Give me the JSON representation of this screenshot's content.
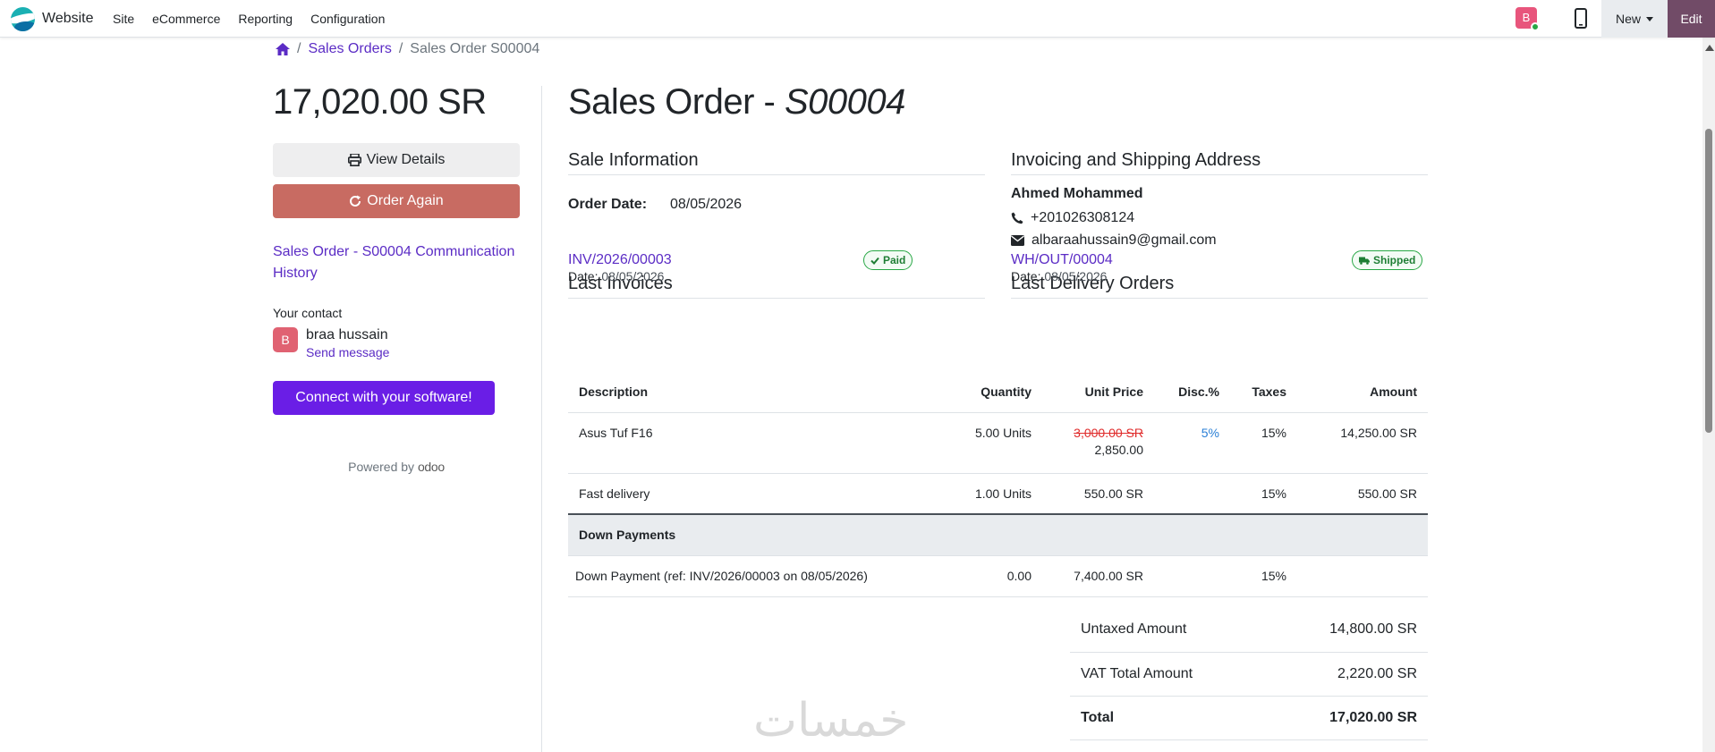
{
  "topbar": {
    "brand": "Website",
    "menu": [
      "Site",
      "eCommerce",
      "Reporting",
      "Configuration"
    ],
    "user_initial": "B",
    "new_label": "New",
    "edit_label": "Edit"
  },
  "breadcrumb": {
    "items": [
      "Sales Orders",
      "Sales Order S00004"
    ]
  },
  "sidebar": {
    "total": "17,020.00 SR",
    "view_details": "View Details",
    "order_again": "Order Again",
    "communication_link": "Sales Order - S00004 Communication History",
    "your_contact": "Your contact",
    "contact_initial": "B",
    "contact_name": "braa hussain",
    "send_message": "Send message",
    "connect_button": "Connect with your software!",
    "powered_by": "Powered by",
    "powered_brand": "odoo"
  },
  "order": {
    "title_prefix": "Sales Order - ",
    "number": "S00004",
    "sale_info_heading": "Sale Information",
    "order_date_label": "Order Date:",
    "order_date": "08/05/2026",
    "address_heading": "Invoicing and Shipping Address",
    "customer_name": "Ahmed Mohammed",
    "phone": "+201026308124",
    "email": "albaraahussain9@gmail.com",
    "invoices_heading": "Last Invoices",
    "invoice_ref": "INV/2026/00003",
    "invoice_status": "Paid",
    "invoice_date_label": "Date:",
    "invoice_date": "08/05/2026",
    "deliveries_heading": "Last Delivery Orders",
    "delivery_ref": "WH/OUT/00004",
    "delivery_status": "Shipped",
    "delivery_date_label": "Date:",
    "delivery_date": "08/05/2026"
  },
  "table": {
    "headers": [
      "Description",
      "Quantity",
      "Unit Price",
      "Disc.%",
      "Taxes",
      "Amount"
    ],
    "rows": [
      {
        "description": "Asus Tuf F16",
        "quantity": "5.00 Units",
        "old_price": "3,000.00 SR",
        "price": "2,850.00",
        "discount": "5%",
        "taxes": "15%",
        "amount": "14,250.00 SR"
      },
      {
        "description": "Fast delivery",
        "quantity": "1.00 Units",
        "price": "550.00 SR",
        "discount": "",
        "taxes": "15%",
        "amount": "550.00 SR"
      }
    ],
    "section_label": "Down Payments",
    "down_payment": {
      "description": "Down Payment (ref: INV/2026/00003 on 08/05/2026)",
      "quantity": "0.00",
      "price": "7,400.00 SR",
      "taxes": "15%",
      "amount": ""
    }
  },
  "totals": {
    "untaxed_label": "Untaxed Amount",
    "untaxed": "14,800.00 SR",
    "vat_label": "VAT Total Amount",
    "vat": "2,220.00 SR",
    "total_label": "Total",
    "total": "17,020.00 SR"
  },
  "watermark": "خمسات",
  "colors": {
    "accent": "#5b2cc5",
    "order_again": "#c86b62",
    "connect": "#6a1ee6",
    "edit": "#714b67",
    "status_green": "#28a745"
  }
}
